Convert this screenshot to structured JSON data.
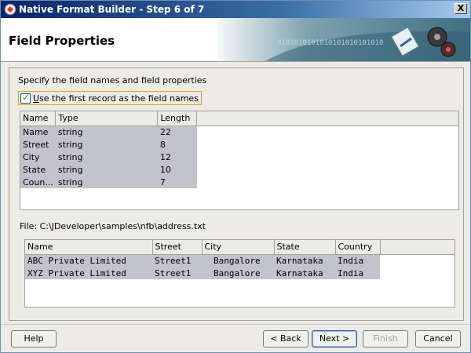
{
  "window": {
    "title": "Native Format Builder - Step 6 of 7",
    "close_label": "X"
  },
  "header": {
    "step_title": "Field Properties",
    "banner_text": "0101010101010101010101010"
  },
  "content": {
    "instruction": "Specify the field names and field properties",
    "use_first_record": {
      "label_underlined": "U",
      "label_rest": "se the first record as the field names",
      "checked": true
    },
    "fields_table": {
      "columns": [
        "Name",
        "Type",
        "Length"
      ],
      "rows": [
        [
          "Name",
          "string",
          "22"
        ],
        [
          "Street",
          "string",
          "8"
        ],
        [
          "City",
          "string",
          "12"
        ],
        [
          "State",
          "string",
          "10"
        ],
        [
          "Coun...",
          "string",
          "7"
        ]
      ]
    },
    "file_label": "File: C:\\JDeveloper\\samples\\nfb\\address.txt",
    "preview_table": {
      "columns": [
        "Name",
        "Street",
        "City",
        "State",
        "Country"
      ],
      "rows": [
        [
          "ABC Private Limited",
          "Street1",
          "Bangalore",
          "Karnataka",
          "India"
        ],
        [
          "XYZ Private Limited",
          "Street1",
          "Bangalore",
          "Karnataka",
          "India"
        ]
      ]
    }
  },
  "footer": {
    "help_label": "Help",
    "back_label": "< Back",
    "next_label": "Next >",
    "finish_label": "Finish",
    "cancel_label": "Cancel"
  },
  "colors": {
    "selection": "#c3c3cc",
    "titlebar": "#0a246a",
    "focus": "#e8a020"
  }
}
